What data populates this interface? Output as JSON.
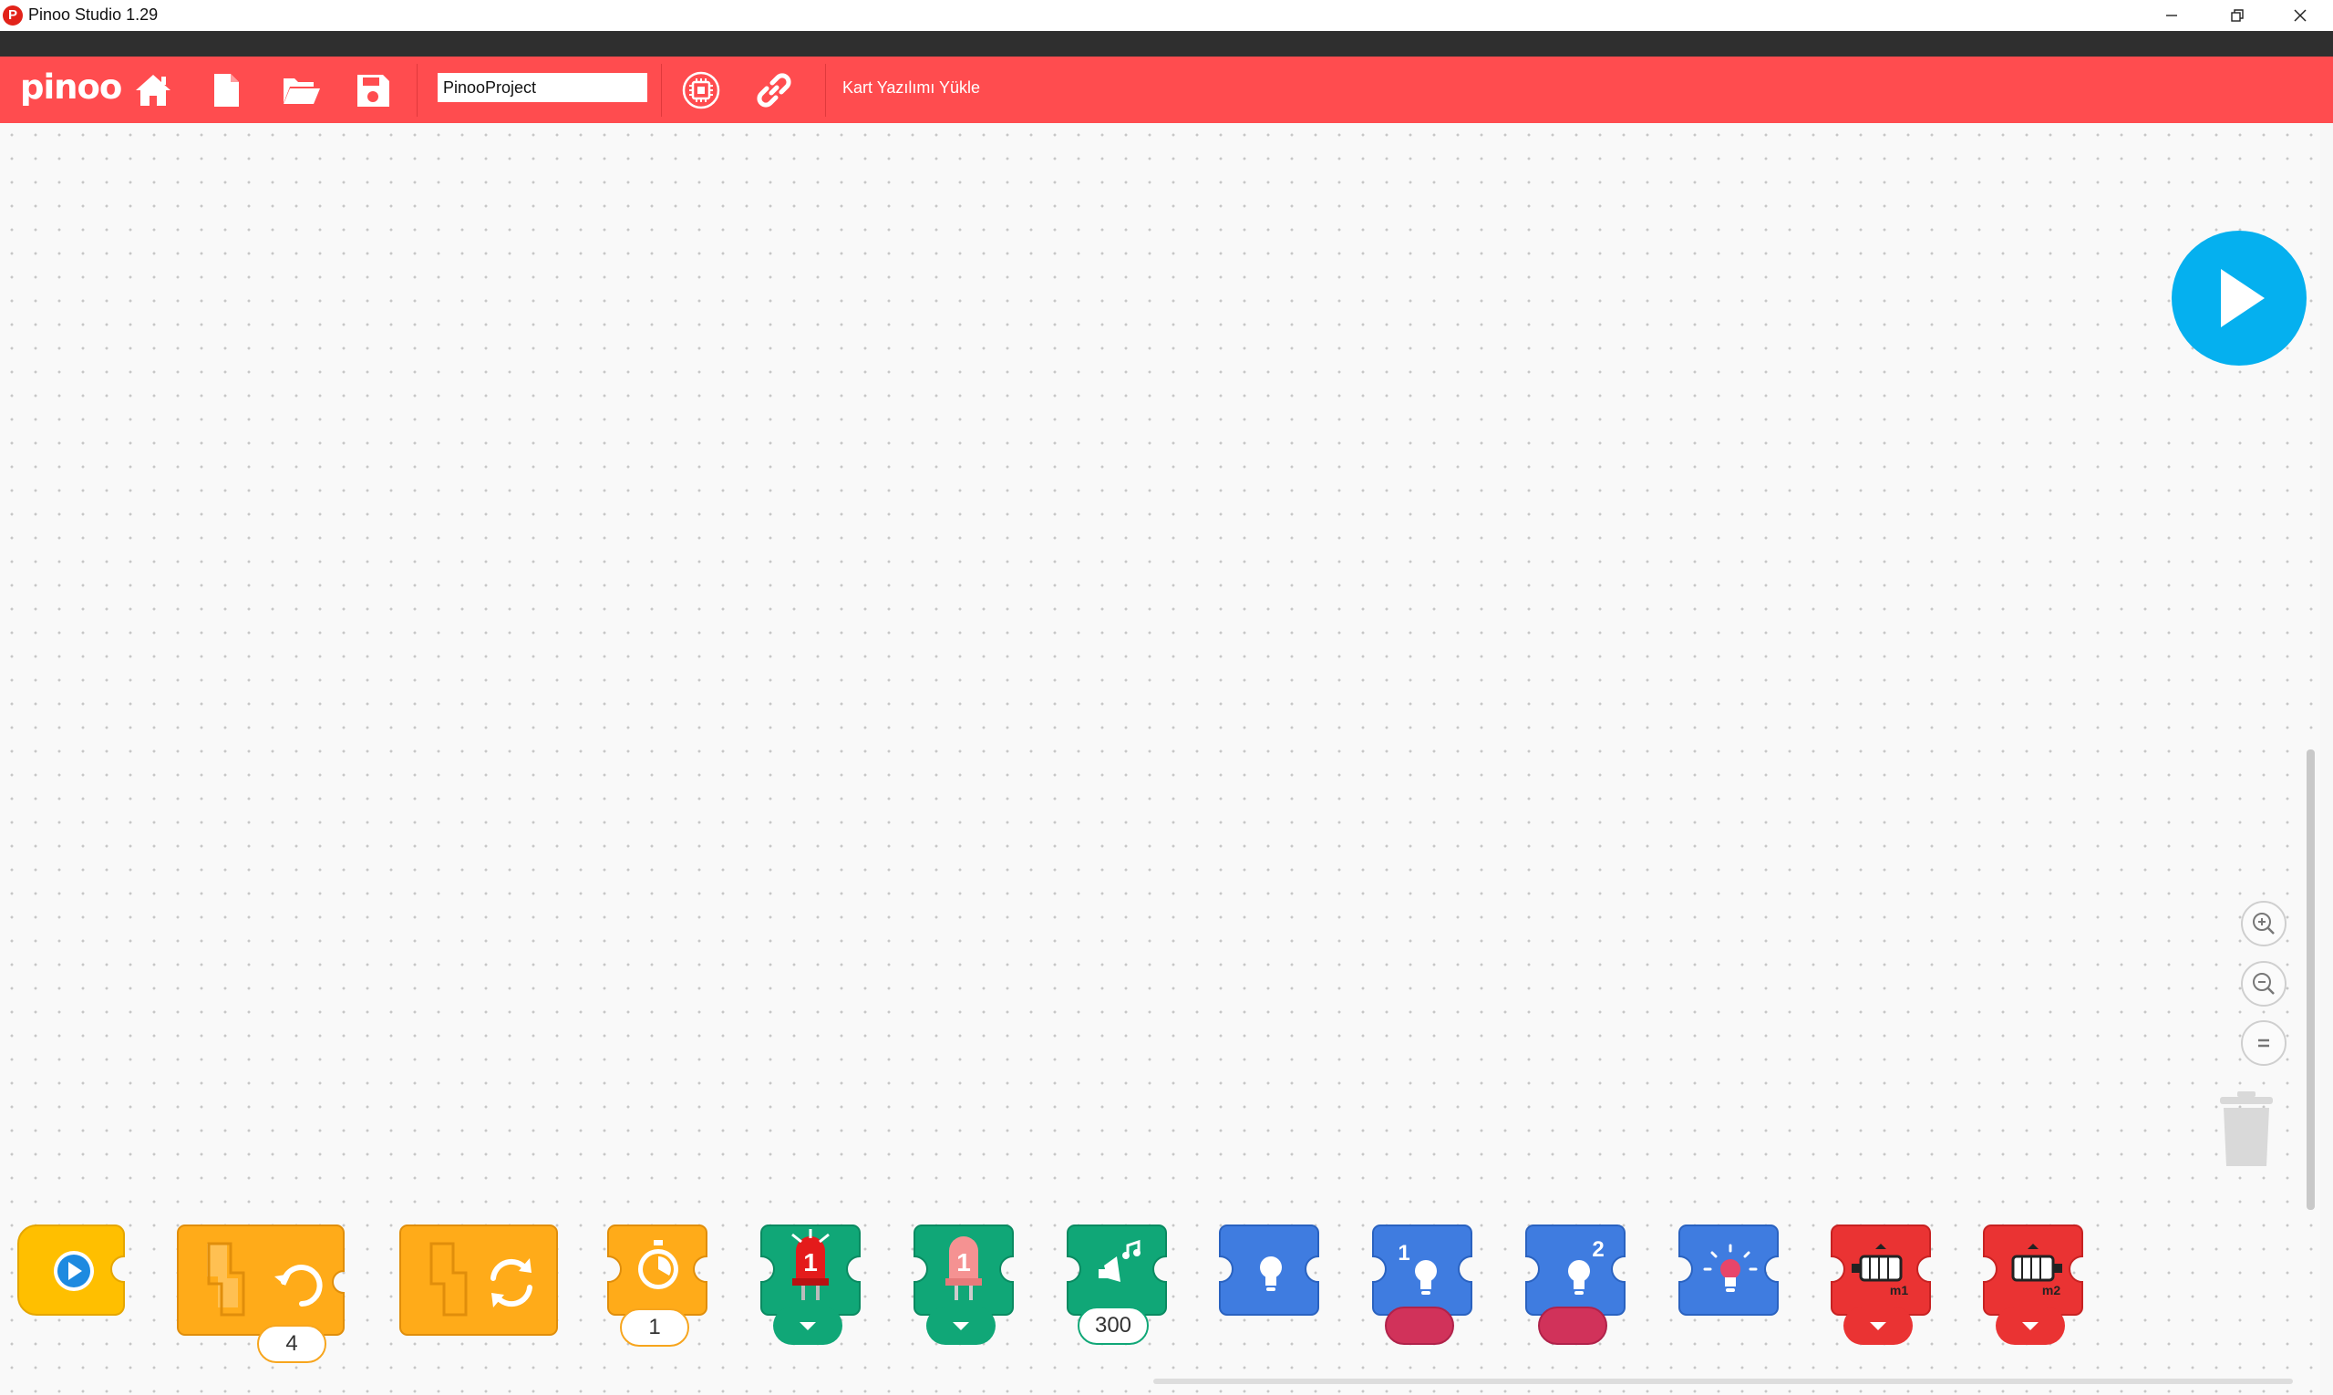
{
  "window": {
    "title": "Pinoo Studio 1.29",
    "icon_letter": "P",
    "controls": [
      "minimize-icon",
      "restore-icon",
      "close-icon"
    ]
  },
  "toolbar": {
    "logo": "pinoo",
    "buttons": [
      "home-icon",
      "new-file-icon",
      "open-folder-icon",
      "save-icon"
    ],
    "project_name": "PinooProject",
    "tool_icons": [
      "chip-icon",
      "link-icon"
    ],
    "upload_label": "Kart Yazılımı Yükle",
    "accent": "#ff4c4f"
  },
  "canvas": {
    "run_button_icon": "play-icon",
    "run_button_color": "#05b0ef",
    "zoom_controls": [
      "zoom-in-icon",
      "zoom-out-icon",
      "zoom-reset-icon"
    ],
    "trash_icon": "trash-icon"
  },
  "palette": {
    "blocks": [
      {
        "name": "start-block",
        "icon": "play-icon",
        "color": "#ffbf00"
      },
      {
        "name": "repeat-block",
        "icon": "repeat-icon",
        "color": "#ffab19",
        "value": "4"
      },
      {
        "name": "forever-block",
        "icon": "forever-icon",
        "color": "#ffab19"
      },
      {
        "name": "wait-block",
        "icon": "stopwatch-icon",
        "color": "#ffab19",
        "value": "1"
      },
      {
        "name": "led-on-block",
        "icon": "led-on-icon",
        "color": "#10a777",
        "badge": "1"
      },
      {
        "name": "led-off-block",
        "icon": "led-off-icon",
        "color": "#10a777",
        "badge": "1"
      },
      {
        "name": "buzzer-block",
        "icon": "buzzer-icon",
        "color": "#10a777",
        "value": "300"
      },
      {
        "name": "rgb-light-block",
        "icon": "bulb-icon",
        "color": "#3f7ce0"
      },
      {
        "name": "rgb-light-1-block",
        "icon": "bulb-icon",
        "color": "#3f7ce0",
        "badge": "1",
        "swatch": "#d1325a"
      },
      {
        "name": "rgb-light-2-block",
        "icon": "bulb-icon",
        "color": "#3f7ce0",
        "badge": "2",
        "swatch": "#d1325a"
      },
      {
        "name": "rgb-off-block",
        "icon": "bulb-glow-icon",
        "color": "#3f7ce0"
      },
      {
        "name": "motor-m1-block",
        "icon": "motor-icon",
        "color": "#ea3333",
        "badge": "m1"
      },
      {
        "name": "motor-m2-block",
        "icon": "motor-icon",
        "color": "#ea3333",
        "badge": "m2"
      }
    ]
  }
}
